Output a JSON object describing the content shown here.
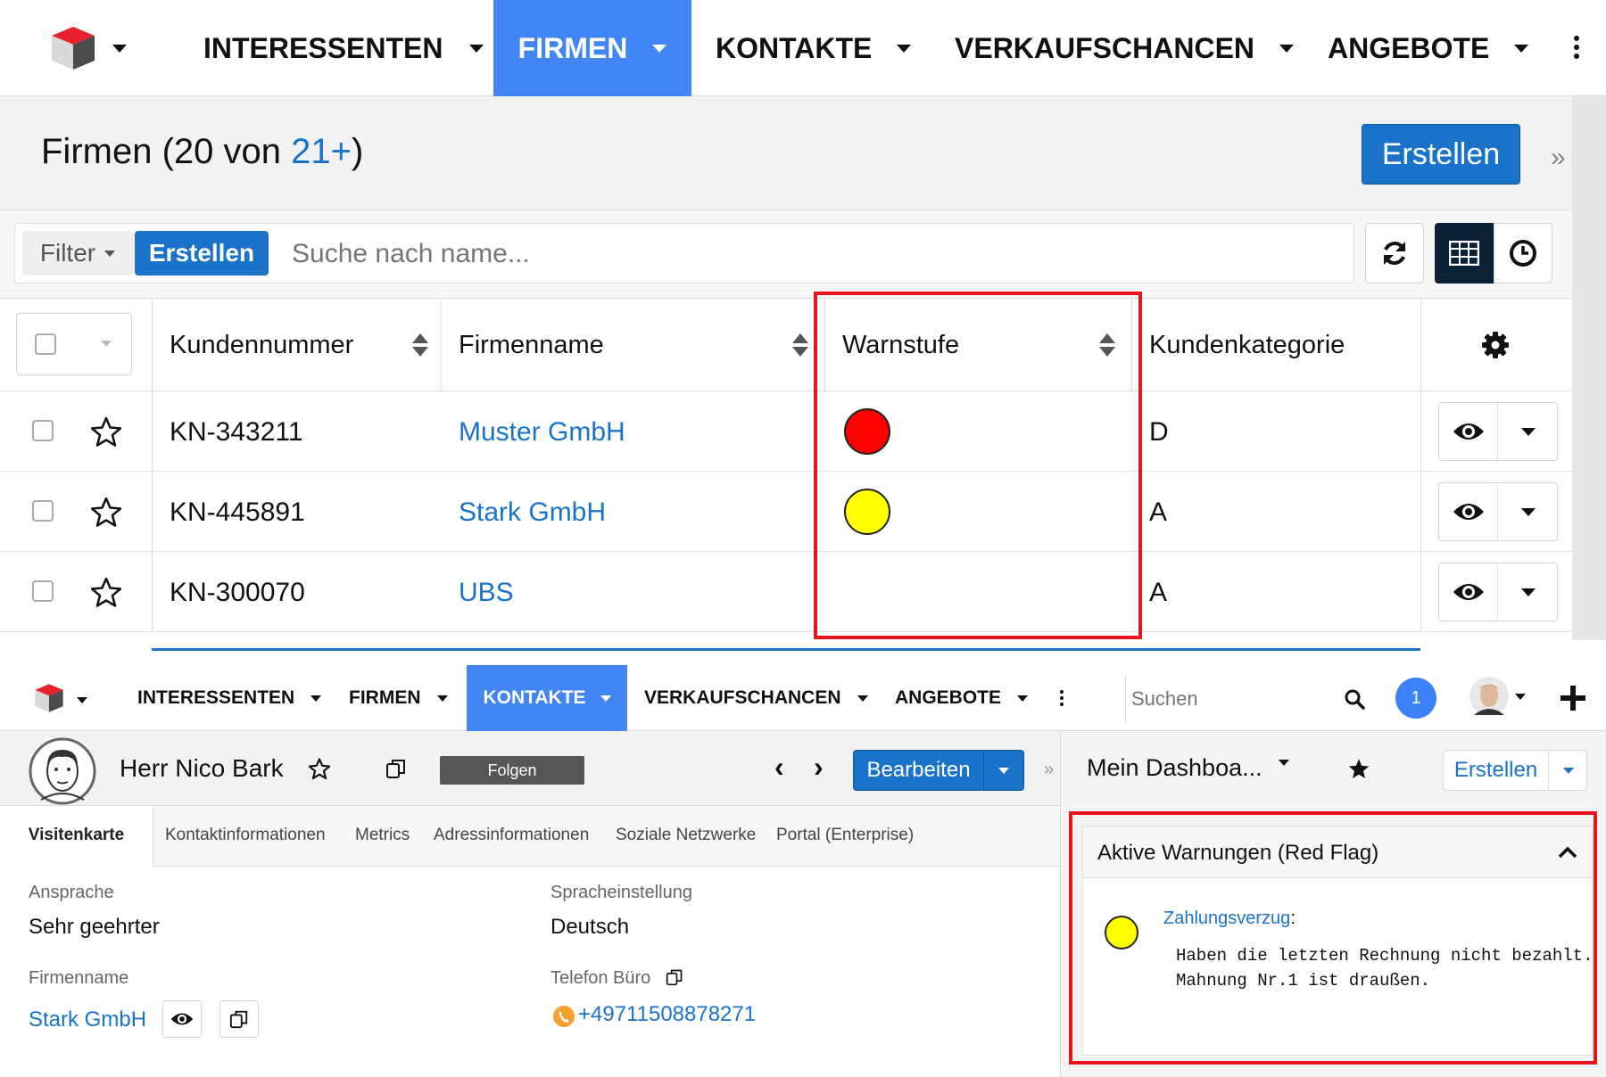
{
  "top_nav": {
    "items": [
      {
        "label": "INTERESSENTEN"
      },
      {
        "label": "FIRMEN"
      },
      {
        "label": "KONTAKTE"
      },
      {
        "label": "VERKAUFSCHANCEN"
      },
      {
        "label": "ANGEBOTE"
      }
    ],
    "active": "FIRMEN",
    "accent": "#4285f4"
  },
  "list_header": {
    "title": "Firmen",
    "count_prefix": "(20 von ",
    "count_link": "21+",
    "count_suffix": ")",
    "create_label": "Erstellen"
  },
  "toolbar": {
    "filter_label": "Filter",
    "create_label": "Erstellen",
    "search_placeholder": "Suche nach name..."
  },
  "table": {
    "columns": [
      "Kundennummer",
      "Firmenname",
      "Warnstufe",
      "Kundenkategorie"
    ],
    "rows": [
      {
        "kundennummer": "KN-343211",
        "firmenname": "Muster GmbH",
        "warnstufe": "red",
        "kategorie": "D"
      },
      {
        "kundennummer": "KN-445891",
        "firmenname": "Stark GmbH",
        "warnstufe": "yellow",
        "kategorie": "A"
      },
      {
        "kundennummer": "KN-300070",
        "firmenname": "UBS",
        "warnstufe": "",
        "kategorie": "A"
      }
    ],
    "warn_colors": {
      "red": "#ff0000",
      "yellow": "#ffff00"
    }
  },
  "bottom_nav": {
    "items": [
      {
        "label": "INTERESSENTEN"
      },
      {
        "label": "FIRMEN"
      },
      {
        "label": "KONTAKTE"
      },
      {
        "label": "VERKAUFSCHANCEN"
      },
      {
        "label": "ANGEBOTE"
      }
    ],
    "active": "KONTAKTE",
    "search_placeholder": "Suchen",
    "notification_count": "1"
  },
  "contact": {
    "name": "Herr Nico Bark",
    "follow_label": "Folgen",
    "edit_label": "Bearbeiten",
    "tabs": [
      "Visitenkarte",
      "Kontaktinformationen",
      "Metrics",
      "Adressinformationen",
      "Soziale Netzwerke",
      "Portal (Enterprise)"
    ],
    "active_tab": "Visitenkarte",
    "fields": {
      "ansprache_label": "Ansprache",
      "ansprache_value": "Sehr geehrter",
      "sprache_label": "Spracheinstellung",
      "sprache_value": "Deutsch",
      "firmenname_label": "Firmenname",
      "firmenname_value": "Stark GmbH",
      "telefon_label": "Telefon Büro",
      "telefon_value": "+49711508878271"
    }
  },
  "dashboard": {
    "title": "Mein Dashboa...",
    "create_label": "Erstellen",
    "widget_title": "Aktive Warnungen (Red Flag)",
    "warning_link": "Zahlungsverzug",
    "warning_colon": ":",
    "warning_line1": "Haben die letzten Rechnung nicht bezahlt.",
    "warning_line2": "Mahnung Nr.1 ist draußen."
  },
  "highlight_color": "#e8131b"
}
